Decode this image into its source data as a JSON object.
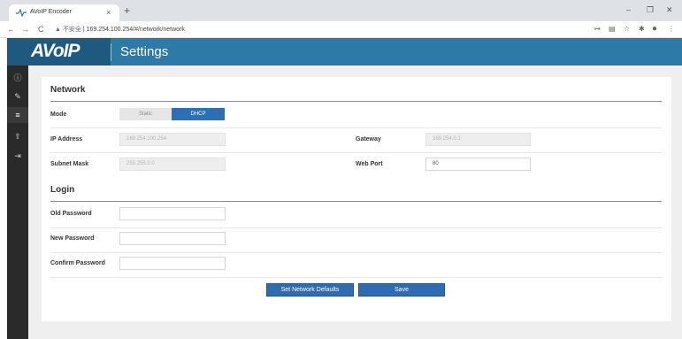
{
  "browser": {
    "tab_title": "AVoIP Encoder",
    "tab_close": "×",
    "new_tab": "+",
    "window_controls": {
      "minimize": "–",
      "restore": "❐",
      "close": "✕"
    },
    "nav": {
      "back": "←",
      "forward": "→",
      "reload": "C"
    },
    "address": {
      "security_label": "▲ 不安全",
      "separator": "|",
      "url": "169.254.100.254/#/network/network"
    },
    "toolbar_icons": [
      "key-icon",
      "translate-icon",
      "star-icon",
      "extensions-icon",
      "profile-icon",
      "menu-icon"
    ]
  },
  "header": {
    "brand": "AVoIP",
    "title": "Settings",
    "colors": {
      "bar": "#2d79a7",
      "brand_box": "#1e5a80"
    }
  },
  "sidebar": {
    "items": [
      {
        "icon": "info-icon",
        "glyph": "ⓘ"
      },
      {
        "icon": "leaf-icon",
        "glyph": "✎"
      },
      {
        "icon": "sliders-icon",
        "glyph": "≡",
        "active": true
      },
      {
        "icon": "upload-icon",
        "glyph": "⇪"
      },
      {
        "icon": "logout-icon",
        "glyph": "⇥"
      }
    ]
  },
  "network": {
    "title": "Network",
    "mode": {
      "label": "Mode",
      "options": [
        "Static",
        "DHCP"
      ],
      "selected": "DHCP"
    },
    "ip_address": {
      "label": "IP Address",
      "value": "169.254.100.254"
    },
    "gateway": {
      "label": "Gateway",
      "value": "169.254.0.1"
    },
    "subnet_mask": {
      "label": "Subnet Mask",
      "value": "255.255.0.0"
    },
    "web_port": {
      "label": "Web Port",
      "value": "80"
    }
  },
  "login": {
    "title": "Login",
    "old_password": {
      "label": "Old Password",
      "value": ""
    },
    "new_password": {
      "label": "New Password",
      "value": ""
    },
    "confirm_password": {
      "label": "Confirm Password",
      "value": ""
    }
  },
  "actions": {
    "defaults_label": "Set Network Defaults",
    "save_label": "Save",
    "accent": "#2f6bae"
  }
}
